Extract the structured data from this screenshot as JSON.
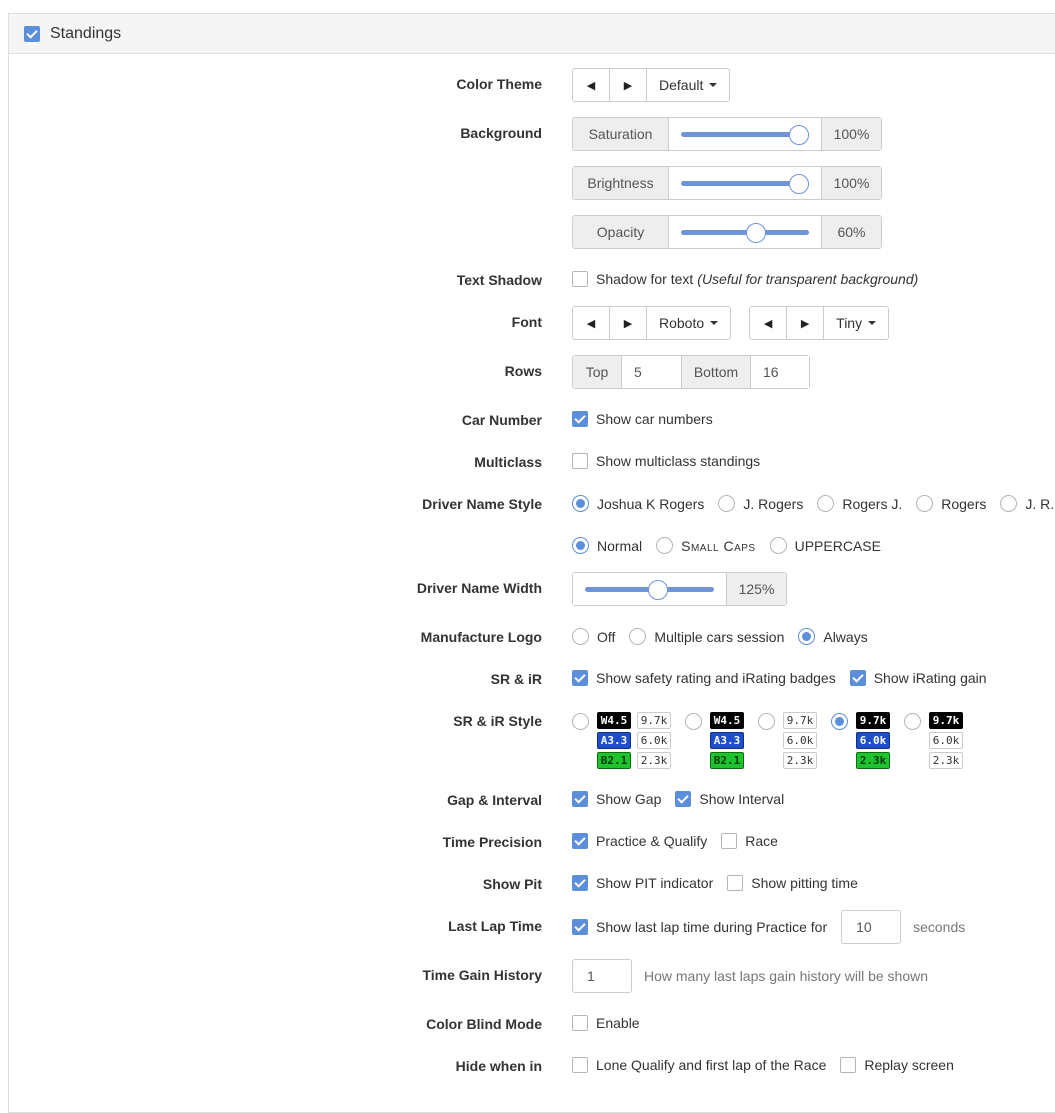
{
  "panel": {
    "title": "Standings",
    "enabled": true
  },
  "colorTheme": {
    "label": "Color Theme",
    "value": "Default"
  },
  "background": {
    "label": "Background",
    "sliders": [
      {
        "name": "Saturation",
        "value": "100%",
        "level": 1.0
      },
      {
        "name": "Brightness",
        "value": "100%",
        "level": 1.0
      },
      {
        "name": "Opacity",
        "value": "60%",
        "level": 0.6
      }
    ]
  },
  "textShadow": {
    "label": "Text Shadow",
    "text": "Shadow for text",
    "hint": "(Useful for transparent background)",
    "checked": false
  },
  "font": {
    "label": "Font",
    "family": "Roboto",
    "size": "Tiny"
  },
  "rows": {
    "label": "Rows",
    "top_label": "Top",
    "top_value": "5",
    "bottom_label": "Bottom",
    "bottom_value": "16"
  },
  "carNumber": {
    "label": "Car Number",
    "text": "Show car numbers",
    "checked": true
  },
  "multiclass": {
    "label": "Multiclass",
    "text": "Show multiclass standings",
    "checked": false
  },
  "driverNameStyle": {
    "label": "Driver Name Style",
    "formats": [
      "Joshua K Rogers",
      "J. Rogers",
      "Rogers J.",
      "Rogers",
      "J. R."
    ],
    "selected_format": 0,
    "cases": [
      "Normal",
      "Small Caps",
      "UPPERCASE"
    ],
    "selected_case": 0
  },
  "driverNameWidth": {
    "label": "Driver Name Width",
    "value": "125%"
  },
  "manufactureLogo": {
    "label": "Manufacture Logo",
    "options": [
      "Off",
      "Multiple cars session",
      "Always"
    ],
    "selected": 2
  },
  "srir": {
    "label": "SR & iR",
    "badges_text": "Show safety rating and iRating badges",
    "badges_checked": true,
    "gain_text": "Show iRating gain",
    "gain_checked": true
  },
  "srirStyle": {
    "label": "SR & iR Style",
    "selected": 3,
    "sr": [
      "W4.5",
      "A3.3",
      "B2.1"
    ],
    "ir": [
      "9.7k",
      "6.0k",
      "2.3k"
    ]
  },
  "gapInterval": {
    "label": "Gap & Interval",
    "gap_text": "Show Gap",
    "interval_text": "Show Interval"
  },
  "timePrecision": {
    "label": "Time Precision",
    "pq_text": "Practice & Qualify",
    "race_text": "Race"
  },
  "showPit": {
    "label": "Show Pit",
    "indicator_text": "Show PIT indicator",
    "time_text": "Show pitting time"
  },
  "lastLapTime": {
    "label": "Last Lap Time",
    "text": "Show last lap time during Practice for",
    "value": "10",
    "unit": "seconds"
  },
  "timeGainHistory": {
    "label": "Time Gain History",
    "value": "1",
    "hint": "How many last laps gain history will be shown"
  },
  "colorBlind": {
    "label": "Color Blind Mode",
    "text": "Enable"
  },
  "hideWhen": {
    "label": "Hide when in",
    "lone_text": "Lone Qualify and first lap of the Race",
    "replay_text": "Replay screen"
  },
  "colors": {
    "accent": "#5b8fd9",
    "slider": "#6f94d8",
    "header_bg": "#f5f5f5"
  }
}
